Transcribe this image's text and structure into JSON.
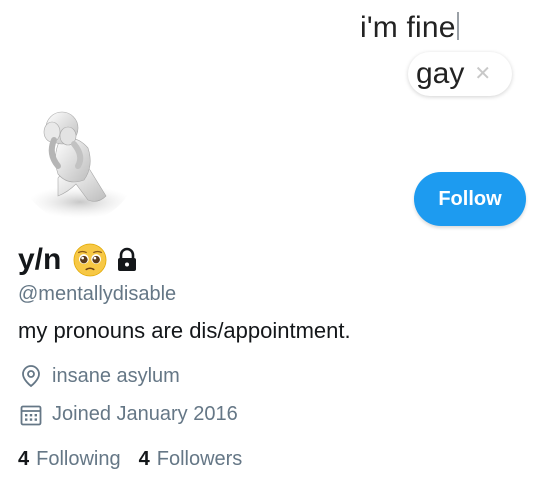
{
  "keyboard_overlay": {
    "typed_text": "i'm fine",
    "suggestion": "gay",
    "dismiss_icon": "close-icon"
  },
  "profile": {
    "avatar_icon": "sad-figure-avatar",
    "display_name": "y/n",
    "name_emoji": "pleading-face-emoji",
    "protected_icon": "lock-icon",
    "handle": "@mentallydisable",
    "bio": "my pronouns are dis/appointment.",
    "location": "insane asylum",
    "location_icon": "location-pin-icon",
    "joined": "Joined January 2016",
    "joined_icon": "calendar-icon",
    "following_count": "4",
    "following_label": "Following",
    "followers_count": "4",
    "followers_label": "Followers"
  },
  "actions": {
    "follow_label": "Follow"
  },
  "colors": {
    "accent": "#1d9bf0",
    "text_primary": "#14171a",
    "text_secondary": "#657786"
  }
}
